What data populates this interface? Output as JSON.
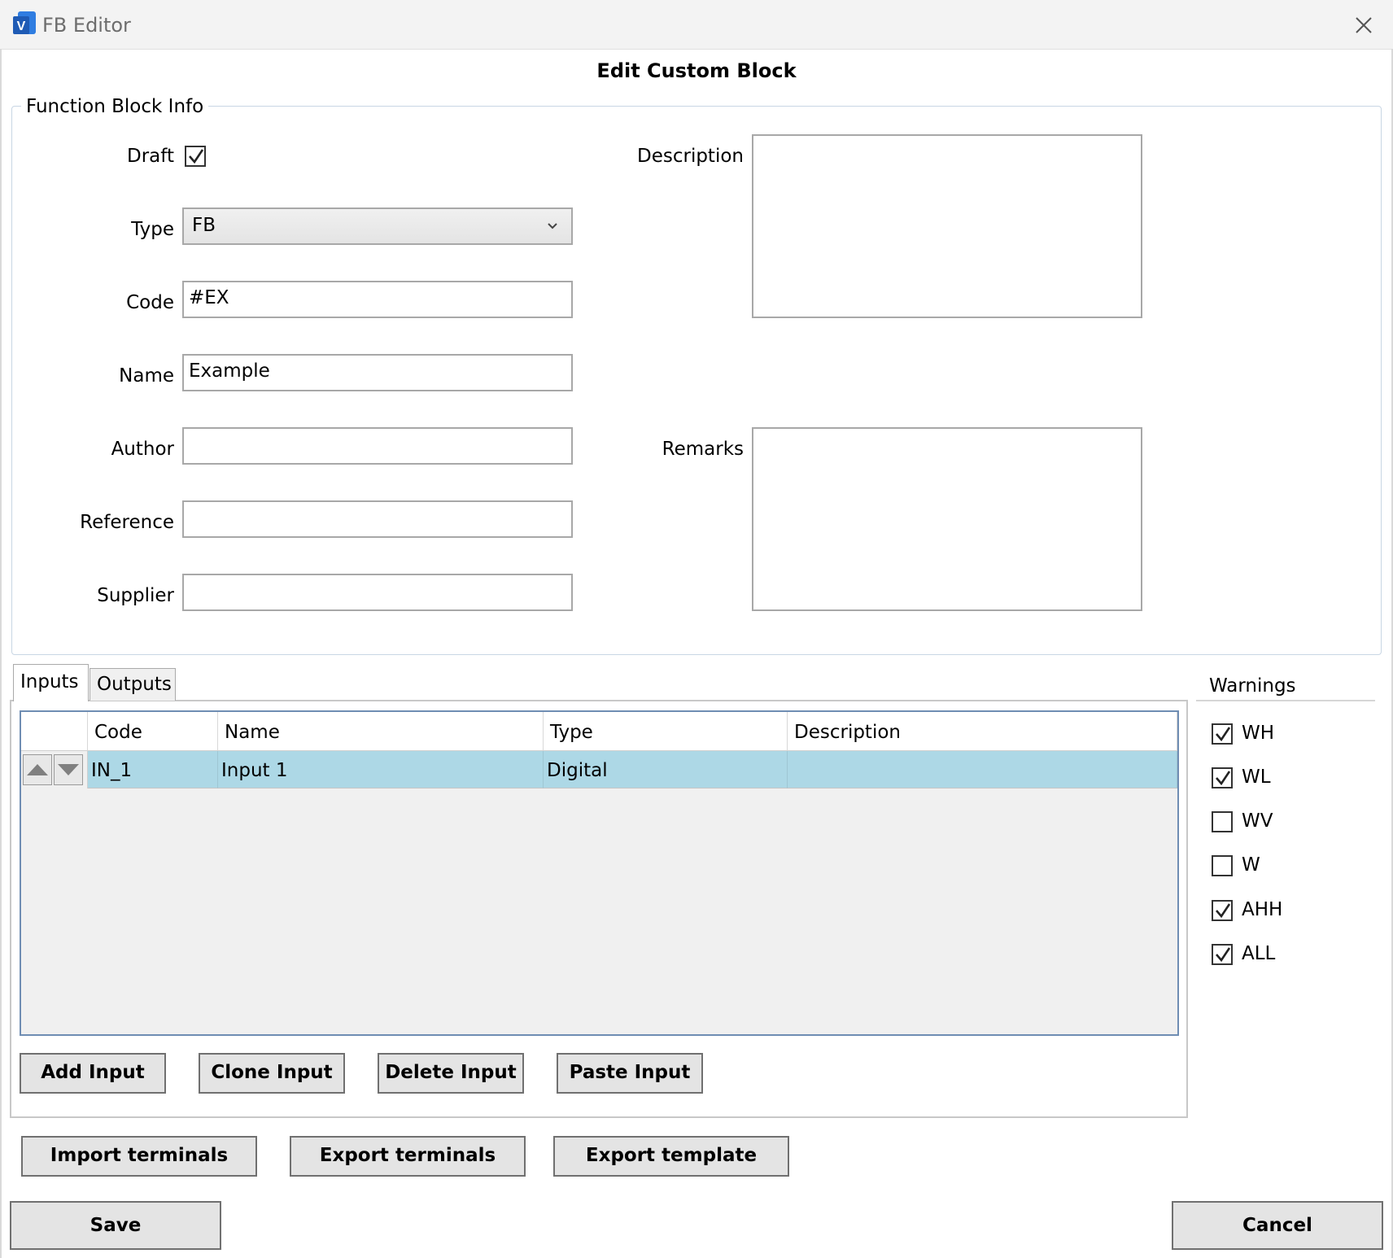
{
  "window": {
    "title": "FB Editor"
  },
  "dialog": {
    "heading": "Edit Custom Block"
  },
  "info": {
    "group_label": "Function Block Info",
    "draft": {
      "label": "Draft",
      "checked": true
    },
    "type": {
      "label": "Type",
      "value": "FB"
    },
    "code": {
      "label": "Code",
      "value": "#EX"
    },
    "name": {
      "label": "Name",
      "value": "Example"
    },
    "author": {
      "label": "Author",
      "value": ""
    },
    "reference": {
      "label": "Reference",
      "value": ""
    },
    "supplier": {
      "label": "Supplier",
      "value": ""
    },
    "description": {
      "label": "Description",
      "value": ""
    },
    "remarks": {
      "label": "Remarks",
      "value": ""
    }
  },
  "tabs": [
    {
      "label": "Inputs",
      "active": true
    },
    {
      "label": "Outputs",
      "active": false
    }
  ],
  "grid": {
    "columns": [
      "Code",
      "Name",
      "Type",
      "Description"
    ],
    "rows": [
      {
        "code": "IN_1",
        "name": "Input 1",
        "type": "Digital",
        "description": ""
      }
    ]
  },
  "grid_buttons": {
    "add": "Add Input",
    "clone": "Clone Input",
    "delete": "Delete Input",
    "paste": "Paste Input"
  },
  "terminal_buttons": {
    "import": "Import terminals",
    "export": "Export terminals",
    "template": "Export template"
  },
  "warnings": {
    "title": "Warnings",
    "items": [
      {
        "label": "WH",
        "checked": true
      },
      {
        "label": "WL",
        "checked": true
      },
      {
        "label": "WV",
        "checked": false
      },
      {
        "label": "W",
        "checked": false
      },
      {
        "label": "AHH",
        "checked": true
      },
      {
        "label": "ALL",
        "checked": true
      }
    ]
  },
  "footer": {
    "save": "Save",
    "cancel": "Cancel"
  },
  "colors": {
    "selected_row": "#add8e6",
    "grid_border": "#6f8db3",
    "brand": "#1f5bb5"
  }
}
